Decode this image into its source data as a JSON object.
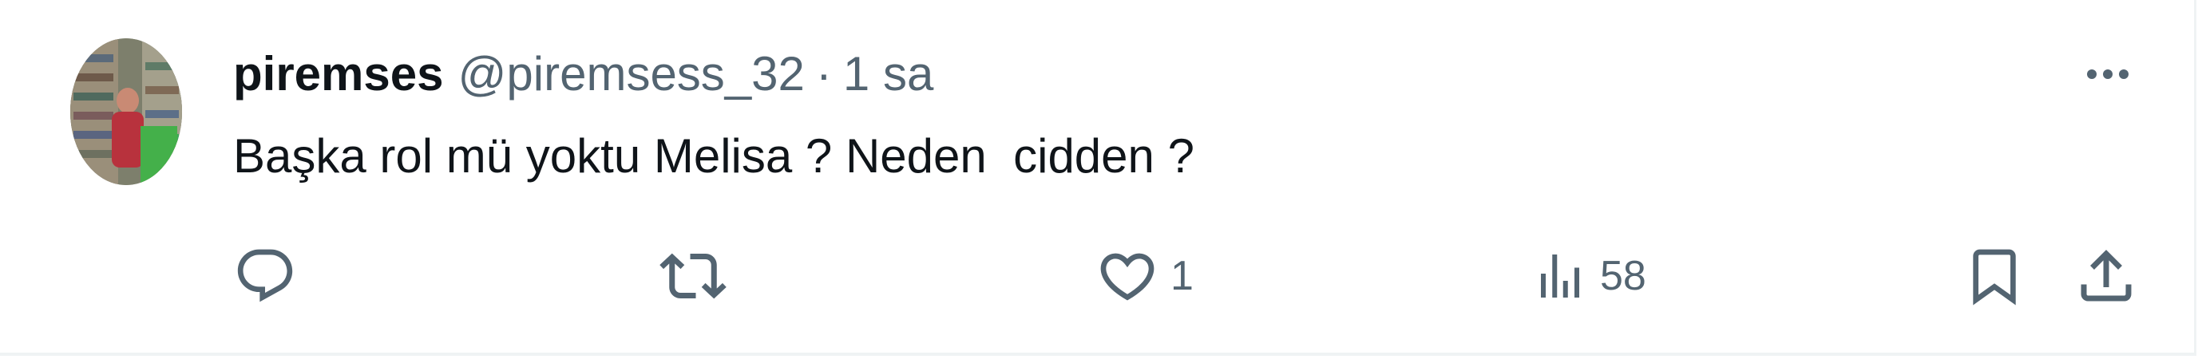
{
  "tweet": {
    "author_name": "piremses",
    "handle": "@piremsess_32",
    "separator": "·",
    "time": "1 sa",
    "text": "Başka rol mü yoktu Melisa ? Neden  cidden ?"
  },
  "actions": {
    "reply_count": "",
    "retweet_count": "",
    "like_count": "1",
    "views_count": "58"
  },
  "icons": {
    "avatar": "avatar-photo",
    "more": "more-horizontal-icon",
    "reply": "reply-icon",
    "retweet": "retweet-icon",
    "like": "heart-icon",
    "views": "views-chart-icon",
    "bookmark": "bookmark-icon",
    "share": "share-icon"
  },
  "colors": {
    "text_primary": "#0f1419",
    "text_secondary": "#536471",
    "border": "#eff3f4"
  }
}
